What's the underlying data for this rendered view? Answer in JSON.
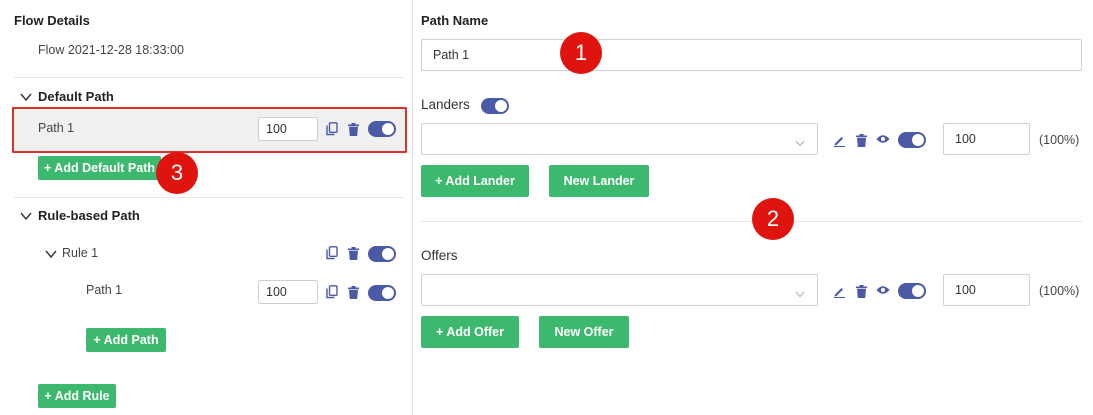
{
  "left": {
    "flow_details_title": "Flow Details",
    "flow_name": "Flow 2021-12-28 18:33:00",
    "default_path_title": "Default Path",
    "default_path": {
      "name": "Path 1",
      "weight": "100"
    },
    "add_default_path_label": "+ Add Default Path",
    "rule_based_title": "Rule-based Path",
    "rule": {
      "name": "Rule 1"
    },
    "rule_path": {
      "name": "Path 1",
      "weight": "100"
    },
    "add_path_label": "+ Add Path",
    "add_rule_label": "+ Add Rule"
  },
  "right": {
    "path_name_label": "Path Name",
    "path_name_value": "Path 1",
    "landers_label": "Landers",
    "lander_weight": "100",
    "lander_percent": "(100%)",
    "add_lander_label": "+ Add Lander",
    "new_lander_label": "New Lander",
    "offers_label": "Offers",
    "offer_weight": "100",
    "offer_percent": "(100%)",
    "add_offer_label": "+ Add Offer",
    "new_offer_label": "New Offer"
  },
  "annotations": {
    "badge_1": "1",
    "badge_2": "2",
    "badge_3": "3"
  },
  "colors": {
    "accent": "#4b5aa6",
    "button_green": "#3cb96f",
    "annotation_red": "#e0140f"
  },
  "icons": [
    "chevron-down-icon",
    "copy-icon",
    "trash-icon",
    "edit-icon",
    "eye-icon",
    "caret-down-icon"
  ]
}
